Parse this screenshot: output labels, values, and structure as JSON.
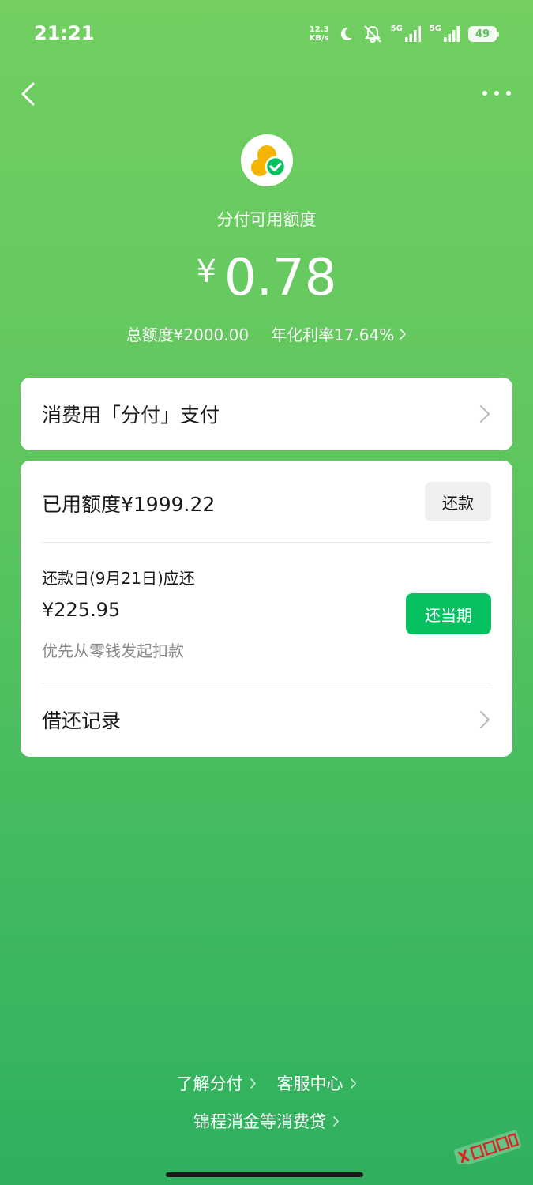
{
  "status_bar": {
    "time": "21:21",
    "net_speed_value": "12.3",
    "net_speed_unit": "KB/s",
    "signal_1": "5G",
    "signal_2": "5G",
    "battery": "49"
  },
  "nav": {
    "back_icon": "chevron-left-icon",
    "more_icon": "more-dots-icon"
  },
  "header": {
    "logo_icon": "fenfu-coins-check-icon",
    "label": "分付可用额度",
    "currency": "¥",
    "amount": "0.78",
    "total_limit": "总额度¥2000.00",
    "annual_rate": "年化利率17.64%"
  },
  "pay_card": {
    "title": "消费用「分付」支付"
  },
  "usage_card": {
    "used_label": "已用额度¥1999.22",
    "repay_button": "还款",
    "due_label": "还款日(9月21日)应还",
    "due_amount": "¥225.95",
    "due_note": "优先从零钱发起扣款",
    "pay_current_button": "还当期",
    "records_label": "借还记录"
  },
  "footer": {
    "link_about": "了解分付",
    "link_service": "客服中心",
    "link_loan": "锦程消金等消费贷"
  },
  "colors": {
    "bg_top": "#72cf60",
    "bg_bottom": "#2fb05e",
    "primary_button": "#07c160",
    "secondary_button": "#f0f0f0"
  }
}
